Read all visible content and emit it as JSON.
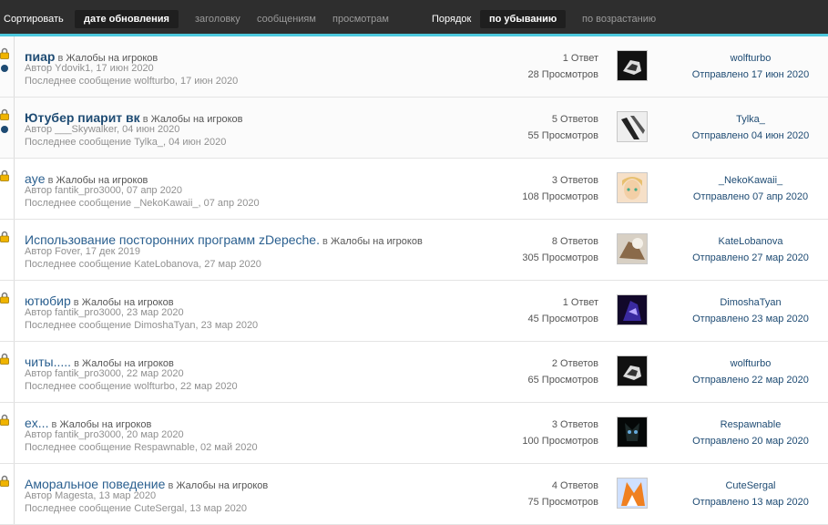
{
  "sortbar": {
    "sort_label": "Сортировать",
    "sort_options": [
      "дате обновления",
      "заголовку",
      "сообщениям",
      "просмотрам"
    ],
    "sort_selected": "дате обновления",
    "order_label": "Порядок",
    "order_options": [
      "по убыванию",
      "по возрастанию"
    ],
    "order_selected": "по убыванию",
    "accent_color": "#4cc8dd"
  },
  "threads": [
    {
      "title": "пиар",
      "in_word": "в",
      "forum": "Жалобы на игроков",
      "author_line": "Автор Ydovik1, 17 июн 2020",
      "last_post_line": "Последнее сообщение wolfturbo, 17 июн 2020",
      "replies": "1 Ответ",
      "views": "28 Просмотров",
      "last_user": "wolfturbo",
      "last_date": "Отправлено 17 июн 2020",
      "locked": true,
      "sticky": true
    },
    {
      "title": "Ютубер пиарит вк",
      "in_word": "в",
      "forum": "Жалобы на игроков",
      "author_line": "Автор ___Skywalker, 04 июн 2020",
      "last_post_line": "Последнее сообщение Tylka_, 04 июн 2020",
      "replies": "5 Ответов",
      "views": "55 Просмотров",
      "last_user": "Tylka_",
      "last_date": "Отправлено 04 июн 2020",
      "locked": true,
      "sticky": true
    },
    {
      "title": "aye",
      "in_word": "в",
      "forum": "Жалобы на игроков",
      "author_line": "Автор fantik_pro3000, 07 апр 2020",
      "last_post_line": "Последнее сообщение _NekoKawaii_, 07 апр 2020",
      "replies": "3 Ответов",
      "views": "108 Просмотров",
      "last_user": "_NekoKawaii_",
      "last_date": "Отправлено 07 апр 2020",
      "locked": true,
      "sticky": false
    },
    {
      "title": "Использование посторонних программ zDepeche.",
      "in_word": "в",
      "forum": "Жалобы на игроков",
      "author_line": "Автор Fover, 17 дек 2019",
      "last_post_line": "Последнее сообщение KateLobanova, 27 мар 2020",
      "replies": "8 Ответов",
      "views": "305 Просмотров",
      "last_user": "KateLobanova",
      "last_date": "Отправлено 27 мар 2020",
      "locked": true,
      "sticky": false
    },
    {
      "title": "ютюбир",
      "in_word": "в",
      "forum": "Жалобы на игроков",
      "author_line": "Автор fantik_pro3000, 23 мар 2020",
      "last_post_line": "Последнее сообщение DimoshaTyan, 23 мар 2020",
      "replies": "1 Ответ",
      "views": "45 Просмотров",
      "last_user": "DimoshaTyan",
      "last_date": "Отправлено 23 мар 2020",
      "locked": true,
      "sticky": false
    },
    {
      "title": "читы.....",
      "in_word": "в",
      "forum": "Жалобы на игроков",
      "author_line": "Автор fantik_pro3000, 22 мар 2020",
      "last_post_line": "Последнее сообщение wolfturbo, 22 мар 2020",
      "replies": "2 Ответов",
      "views": "65 Просмотров",
      "last_user": "wolfturbo",
      "last_date": "Отправлено 22 мар 2020",
      "locked": true,
      "sticky": false
    },
    {
      "title": "ex...",
      "in_word": "в",
      "forum": "Жалобы на игроков",
      "author_line": "Автор fantik_pro3000, 20 мар 2020",
      "last_post_line": "Последнее сообщение Respawnable, 02 май 2020",
      "replies": "3 Ответов",
      "views": "100 Просмотров",
      "last_user": "Respawnable",
      "last_date": "Отправлено 20 мар 2020",
      "locked": true,
      "sticky": false
    },
    {
      "title": "Аморальное поведение",
      "in_word": "в",
      "forum": "Жалобы на игроков",
      "author_line": "Автор Magesta, 13 мар 2020",
      "last_post_line": "Последнее сообщение CuteSergal, 13 мар 2020",
      "replies": "4 Ответов",
      "views": "75 Просмотров",
      "last_user": "CuteSergal",
      "last_date": "Отправлено 13 мар 2020",
      "locked": true,
      "sticky": false
    }
  ]
}
